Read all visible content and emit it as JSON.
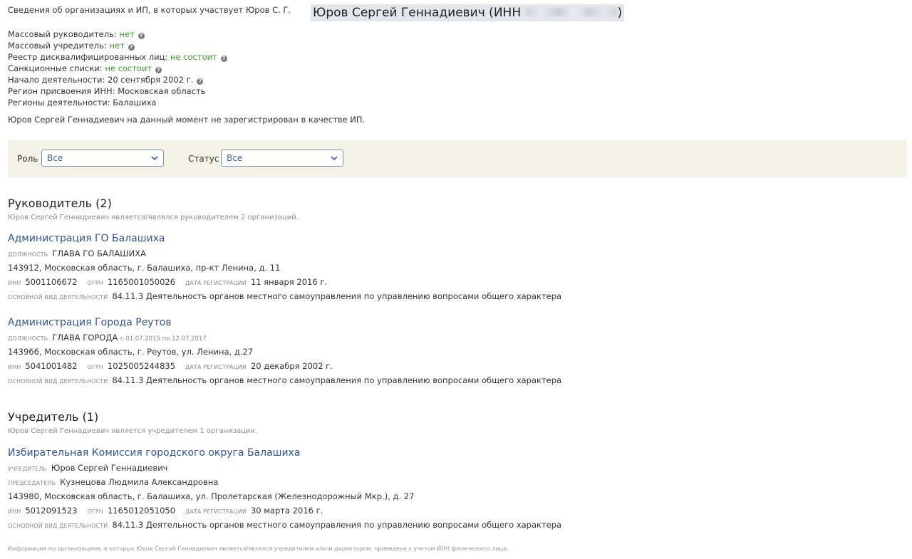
{
  "header": {
    "intro": "Сведения об организациях и ИП, в которых участвует Юров С. Г.",
    "name_prefix": "Юров Сергей Геннадиевич (ИНН",
    "name_suffix": ")"
  },
  "facts": [
    {
      "label": "Массовый руководитель: ",
      "value": "нет",
      "green": true,
      "help": true
    },
    {
      "label": "Массовый учредитель: ",
      "value": "нет",
      "green": true,
      "help": true
    },
    {
      "label": "Реестр дисквалифицированных лиц: ",
      "value": "не состоит",
      "green": true,
      "help": true
    },
    {
      "label": "Санкционные списки: ",
      "value": "не состоит",
      "green": true,
      "help": true
    },
    {
      "label": "Начало деятельности: ",
      "value": "20 сентября 2002 г.",
      "green": false,
      "help": true
    },
    {
      "label": "Регион присвоения ИНН: ",
      "value": "Московская область",
      "green": false,
      "help": false
    },
    {
      "label": "Регионы деятельности: ",
      "value": "Балашиха",
      "green": false,
      "help": false
    }
  ],
  "not_ip": "Юров Сергей Геннадиевич на данный момент не зарегистрирован в качестве ИП.",
  "filters": {
    "role_label": "Роль",
    "role_value": "Все",
    "status_label": "Статус",
    "status_value": "Все"
  },
  "sections": {
    "head": {
      "title": "Руководитель (2)",
      "subtitle": "Юров Сергей Геннадиевич является/являлся руководителем 2 организаций."
    },
    "founder": {
      "title": "Учредитель (1)",
      "subtitle": "Юров Сергей Геннадиевич является учредителем 1 организации."
    }
  },
  "orgs": [
    {
      "name": "Администрация ГО Балашиха",
      "position_label": "должность",
      "position": "ГЛАВА ГО БАЛАШИХА",
      "position_period": "",
      "address": "143912, Московская область, г. Балашиха, пр-кт Ленина, д. 11",
      "inn_label": "инн",
      "inn": "5001106672",
      "ogrn_label": "огрн",
      "ogrn": "1165001050026",
      "reg_label": "дата регистрации",
      "reg_date": "11 января 2016 г.",
      "activity_label": "основной вид деятельности",
      "activity": "84.11.3 Деятельность органов местного самоуправления по управлению вопросами общего характера"
    },
    {
      "name": "Администрация Города Реутов",
      "position_label": "должность",
      "position": "ГЛАВА ГОРОДА",
      "position_period": "с 01.07.2015 по 12.07.2017",
      "address": "143966, Московская область, г. Реутов, ул. Ленина, д.27",
      "inn_label": "инн",
      "inn": "5041001482",
      "ogrn_label": "огрн",
      "ogrn": "1025005244835",
      "reg_label": "дата регистрации",
      "reg_date": "20 декабря 2002 г.",
      "activity_label": "основной вид деятельности",
      "activity": "84.11.3 Деятельность органов местного самоуправления по управлению вопросами общего характера"
    },
    {
      "name": "Избирательная Комиссия городского округа Балашиха",
      "founder_label": "учредитель",
      "founder": "Юров Сергей Геннадиевич",
      "chair_label": "председатель",
      "chair": "Кузнецова Людмила Александровна",
      "address": "143980, Московская область, г. Балашиха, ул. Пролетарская (Железнодорожный Мкр.), д. 27",
      "inn_label": "инн",
      "inn": "5012091523",
      "ogrn_label": "огрн",
      "ogrn": "1165012051050",
      "reg_label": "дата регистрации",
      "reg_date": "30 марта 2016 г.",
      "activity_label": "основной вид деятельности",
      "activity": "84.11.3 Деятельность органов местного самоуправления по управлению вопросами общего характера"
    }
  ],
  "footnote": "Информация по организациям, в которых Юров Сергей Геннадиевич является/являлся учредителем и/или директором, приведена с учетом ИНН физического лица.",
  "colors": {
    "accent": "#2f5496",
    "green": "#3e9b2e",
    "filter_bg": "#f2f2e6"
  },
  "icons": {
    "help": "question-circle-icon",
    "select_arrow": "chevron-down-icon"
  }
}
